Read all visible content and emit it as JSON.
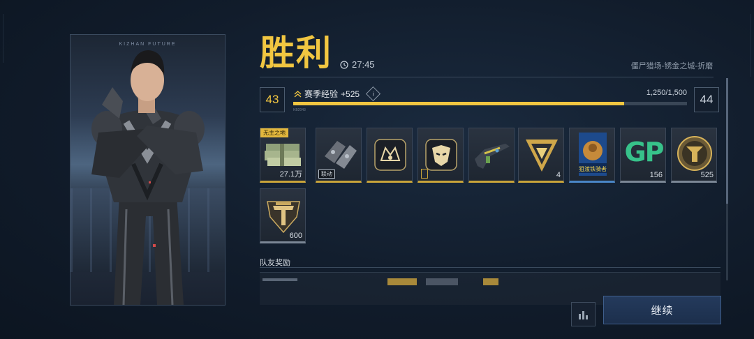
{
  "header": {
    "title": "胜利",
    "time": "27:45",
    "mode": "僵尸猎场-锈金之城-折磨"
  },
  "character": {
    "brand_text": "KIZHAN FUTURE"
  },
  "progress": {
    "current_level": "43",
    "next_level": "44",
    "xp_label": "赛季经验",
    "xp_gain": "+525",
    "info_icon": "i",
    "xp_count": "1,250/1,500",
    "fill_fraction": 0.84,
    "sub_text": "KB2043"
  },
  "rewards": [
    {
      "icon": "cash-stack-icon",
      "qty": "27.1万",
      "tag": "无主之地",
      "rarity": "gold"
    },
    {
      "icon": "gauntlet-icon",
      "badge": "联动",
      "rarity": "gold"
    },
    {
      "icon": "emblem-crown-icon",
      "rarity": "gold"
    },
    {
      "icon": "emblem-mask-icon",
      "rarity": "gold"
    },
    {
      "icon": "rifle-icon",
      "rarity": "gold"
    },
    {
      "icon": "triangle-token-icon",
      "qty": "4",
      "rarity": "gold"
    },
    {
      "icon": "poster-card-icon",
      "poster_text": "狙渡铁骑者",
      "rarity": "blue"
    },
    {
      "icon": "gp-points-icon",
      "qty": "156",
      "gp_text": "GP",
      "rarity": "grey"
    },
    {
      "icon": "y-coin-icon",
      "qty": "525",
      "rarity": "grey"
    },
    {
      "icon": "ttf-badge-icon",
      "qty": "600",
      "rarity": "grey"
    }
  ],
  "team": {
    "label": "队友奖励"
  },
  "buttons": {
    "continue": "继续"
  },
  "colors": {
    "accent_gold": "#f1c641",
    "button_blue": "#243a5c",
    "bg": "#111c2b"
  }
}
